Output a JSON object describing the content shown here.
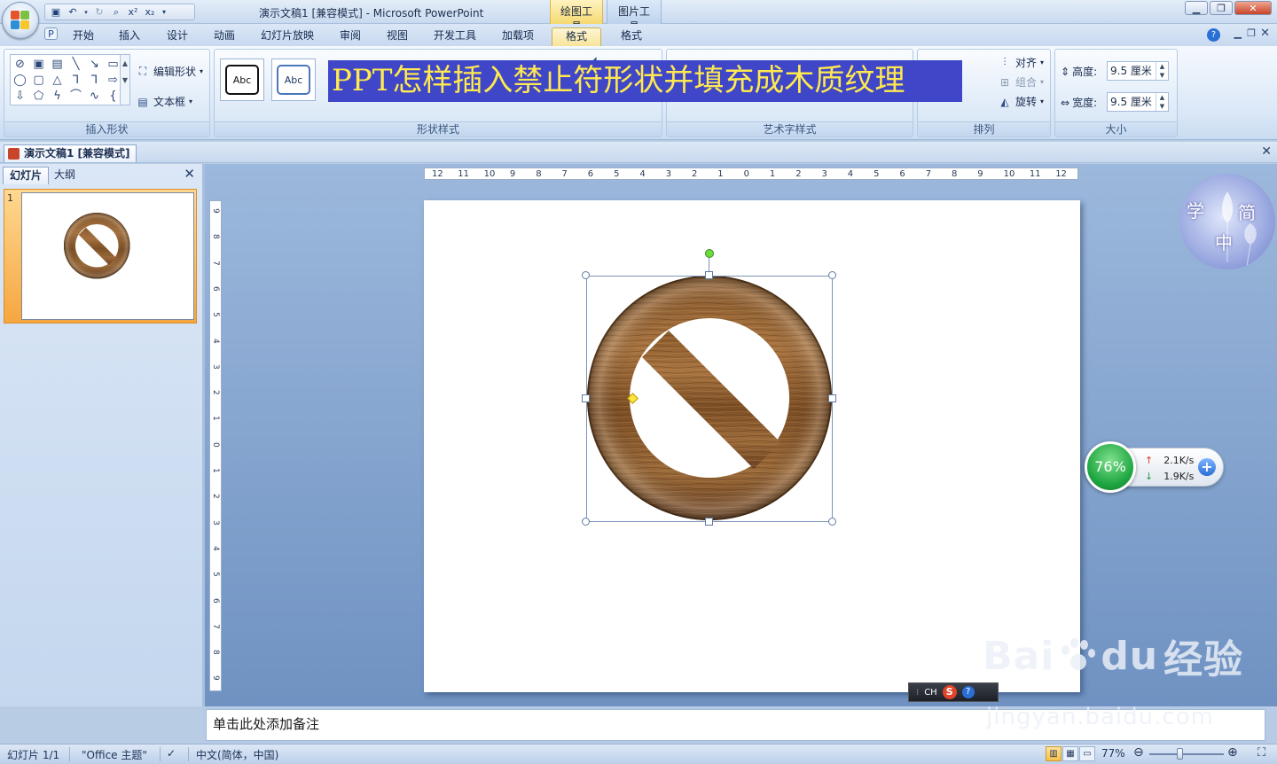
{
  "titlebar": {
    "title": "演示文稿1 [兼容模式] - Microsoft PowerPoint",
    "context_tab_drawing": "绘图工具",
    "context_tab_picture": "图片工具",
    "qat_icons": [
      "save-icon",
      "undo-icon",
      "redo-icon",
      "print-preview-icon",
      "superscript-icon",
      "subscript-icon",
      "customize-qat-icon"
    ],
    "superscript_label": "x²",
    "subscript_label": "x₂"
  },
  "tabs": [
    {
      "label": "开始"
    },
    {
      "label": "插入"
    },
    {
      "label": "设计"
    },
    {
      "label": "动画"
    },
    {
      "label": "幻灯片放映"
    },
    {
      "label": "审阅"
    },
    {
      "label": "视图"
    },
    {
      "label": "开发工具"
    },
    {
      "label": "加载项"
    },
    {
      "label": "格式",
      "active": true
    },
    {
      "label": "格式"
    }
  ],
  "ribbon": {
    "insert_shapes": {
      "label": "插入形状",
      "edit_shape": "编辑形状",
      "text_box": "文本框"
    },
    "shape_styles": {
      "label": "形状样式",
      "swatch_1": "Abc",
      "swatch_2": "Abc"
    },
    "wordart_styles": {
      "label": "艺术字样式"
    },
    "arrange": {
      "label": "排列",
      "align": "对齐",
      "group": "组合",
      "rotate": "旋转"
    },
    "size": {
      "label": "大小",
      "height_label": "高度:",
      "height_value": "9.5 厘米",
      "width_label": "宽度:",
      "width_value": "9.5 厘米"
    }
  },
  "banner": {
    "text": "PPT怎样插入禁止符形状并填充成木质纹理"
  },
  "doc_tab": {
    "title": "演示文稿1 [兼容模式]"
  },
  "left_pane": {
    "tab_slides": "幻灯片",
    "tab_outline": "大纲",
    "slide_number": "1"
  },
  "ruler": {
    "horizontal": [
      "12",
      "11",
      "10",
      "9",
      "8",
      "7",
      "6",
      "5",
      "4",
      "3",
      "2",
      "1",
      "0",
      "1",
      "2",
      "3",
      "4",
      "5",
      "6",
      "7",
      "8",
      "9",
      "10",
      "11",
      "12"
    ],
    "vertical": [
      "9",
      "8",
      "7",
      "6",
      "5",
      "4",
      "3",
      "2",
      "1",
      "0",
      "1",
      "2",
      "3",
      "4",
      "5",
      "6",
      "7",
      "8",
      "9"
    ]
  },
  "net_widget": {
    "percent": "76%",
    "upload": "2.1K/s",
    "download": "1.9K/s"
  },
  "avatar": {
    "chars": [
      "学",
      "简",
      "中"
    ]
  },
  "ime": {
    "label": "CH",
    "sogou": "S",
    "help": "?"
  },
  "watermark": {
    "brand": "Bai",
    "brand2": "du",
    "product": "经验",
    "url": "jingyan.baidu.com"
  },
  "notes": {
    "placeholder": "单击此处添加备注"
  },
  "status": {
    "slide_count": "幻灯片 1/1",
    "theme": "\"Office 主题\"",
    "language": "中文(简体，中国)",
    "zoom": "77%"
  }
}
